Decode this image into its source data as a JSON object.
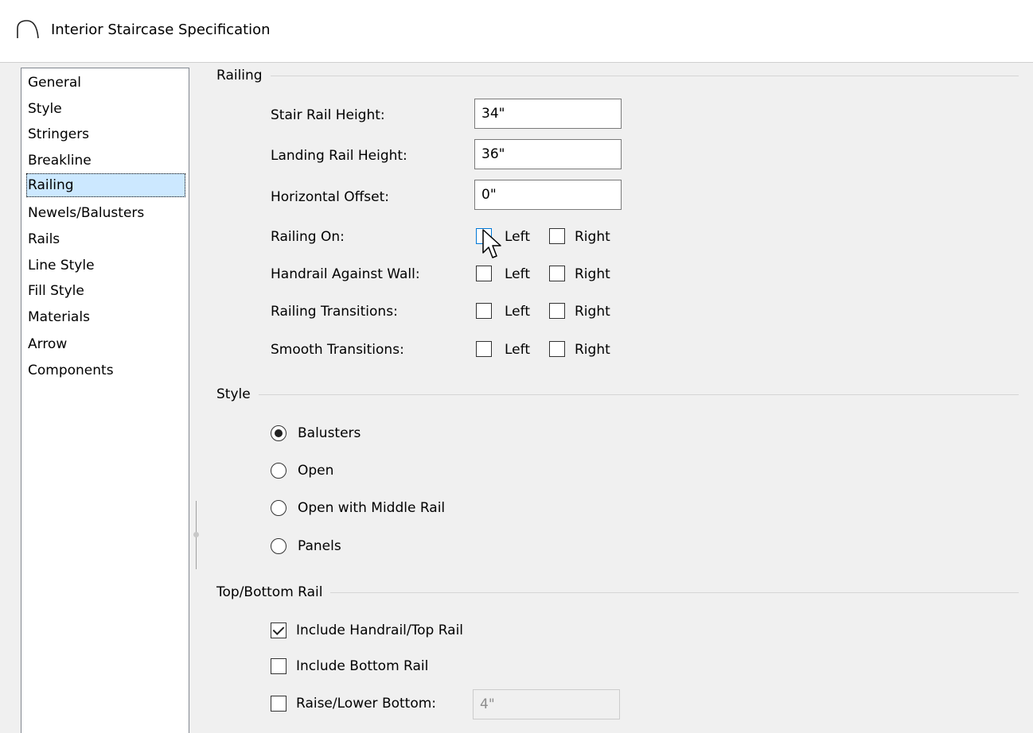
{
  "window": {
    "title": "Interior Staircase Specification",
    "icon": "staircase-arch-icon"
  },
  "nav": {
    "items": [
      {
        "label": "General"
      },
      {
        "label": "Style"
      },
      {
        "label": "Stringers"
      },
      {
        "label": "Breakline"
      },
      {
        "label": "Railing",
        "selected": true
      },
      {
        "label": "Newels/Balusters"
      },
      {
        "label": "Rails"
      },
      {
        "label": "Line Style"
      },
      {
        "label": "Fill Style"
      },
      {
        "label": "Materials"
      },
      {
        "label": "Arrow"
      },
      {
        "label": "Components"
      }
    ]
  },
  "railing": {
    "group_title": "Railing",
    "stair_rail_height": {
      "label": "Stair Rail Height:",
      "value": "34\""
    },
    "landing_rail_height": {
      "label": "Landing Rail Height:",
      "value": "36\""
    },
    "horizontal_offset": {
      "label": "Horizontal Offset:",
      "value": "0\""
    },
    "left_label": "Left",
    "right_label": "Right",
    "railing_on": {
      "label": "Railing On:",
      "left": false,
      "right": false
    },
    "handrail_against_wall": {
      "label": "Handrail Against Wall:",
      "left": false,
      "right": false
    },
    "railing_transitions": {
      "label": "Railing Transitions:",
      "left": false,
      "right": false
    },
    "smooth_transitions": {
      "label": "Smooth Transitions:",
      "left": false,
      "right": false
    }
  },
  "style": {
    "group_title": "Style",
    "options": [
      {
        "label": "Balusters",
        "selected": true
      },
      {
        "label": "Open",
        "selected": false
      },
      {
        "label": "Open with Middle Rail",
        "selected": false
      },
      {
        "label": "Panels",
        "selected": false
      }
    ]
  },
  "top_bottom_rail": {
    "group_title": "Top/Bottom Rail",
    "include_handrail": {
      "label": "Include Handrail/Top Rail",
      "checked": true
    },
    "include_bottom_rail": {
      "label": "Include Bottom Rail",
      "checked": false
    },
    "raise_lower_bottom": {
      "label": "Raise/Lower Bottom:",
      "checked": false,
      "value": "4\""
    }
  },
  "colors": {
    "selection": "#cce8ff",
    "focus_blue": "#0078d7",
    "dialog_bg": "#f0f0f0"
  }
}
